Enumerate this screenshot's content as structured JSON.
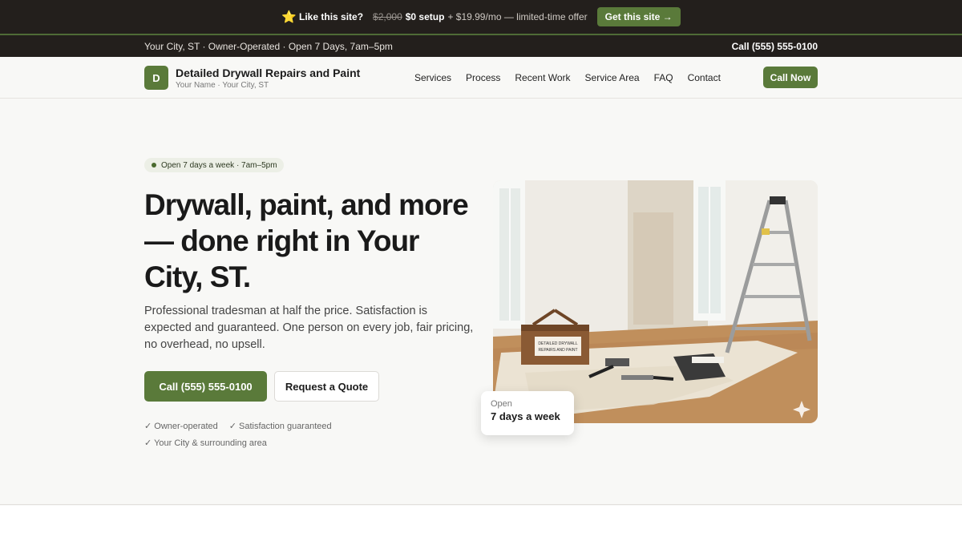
{
  "promo": {
    "star": "⭐",
    "like_text": "Like this site?",
    "old_price": "$2,000",
    "setup": "$0 setup",
    "rest": "+ $19.99/mo — limited-time offer",
    "cta": "Get this site →"
  },
  "infobar": {
    "left": "Your City, ST · Owner-Operated · Open 7 Days, 7am–5pm",
    "call": "Call (555) 555-0100"
  },
  "header": {
    "logo_letter": "D",
    "brand_name": "Detailed Drywall Repairs and Paint",
    "brand_sub": "Your Name · Your City, ST",
    "nav": [
      "Services",
      "Process",
      "Recent Work",
      "Service Area",
      "FAQ",
      "Contact"
    ],
    "call_now": "Call Now"
  },
  "hero": {
    "pill": "Open 7 days a week · 7am–5pm",
    "headline": "Drywall, paint, and more — done right in Your City, ST.",
    "lede": "Professional tradesman at half the price. Satisfaction is expected and guaranteed. One person on every job, fair pricing, no overhead, no upsell.",
    "primary_cta": "Call (555) 555-0100",
    "secondary_cta": "Request a Quote",
    "checks": [
      "✓ Owner-operated",
      "✓ Satisfaction guaranteed",
      "✓ Your City & surrounding area"
    ],
    "toolbox_label_1": "DETAILED DRYWALL",
    "toolbox_label_2": "REPAIRS AND PAINT",
    "open_card": {
      "label": "Open",
      "value": "7 days a week"
    }
  },
  "colors": {
    "accent": "#5a7a3a",
    "dark_bar": "#231f1c",
    "background": "#f8f8f6"
  }
}
